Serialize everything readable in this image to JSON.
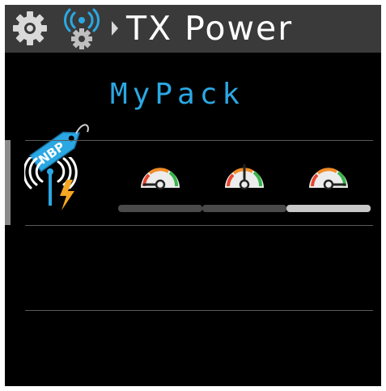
{
  "header": {
    "title": "TX Power",
    "icons": [
      "gear-icon",
      "radio-gear-icon",
      "breadcrumb-arrow-icon"
    ]
  },
  "pack": {
    "name": "MyPack",
    "tag_text": "NBP"
  },
  "tx_power": {
    "icon": "antenna-lightning-icon",
    "options": [
      {
        "icon": "gauge-low-icon",
        "level": "low",
        "selected": false
      },
      {
        "icon": "gauge-medium-icon",
        "level": "medium",
        "selected": false
      },
      {
        "icon": "gauge-high-icon",
        "level": "high",
        "selected": true
      }
    ]
  },
  "colors": {
    "accent": "#2ba8e3",
    "header_bg": "#3a3a3a",
    "gauge_green": "#39b54a",
    "gauge_orange": "#f28c28",
    "gauge_red": "#e8452c",
    "bolt": "#f5a623"
  }
}
